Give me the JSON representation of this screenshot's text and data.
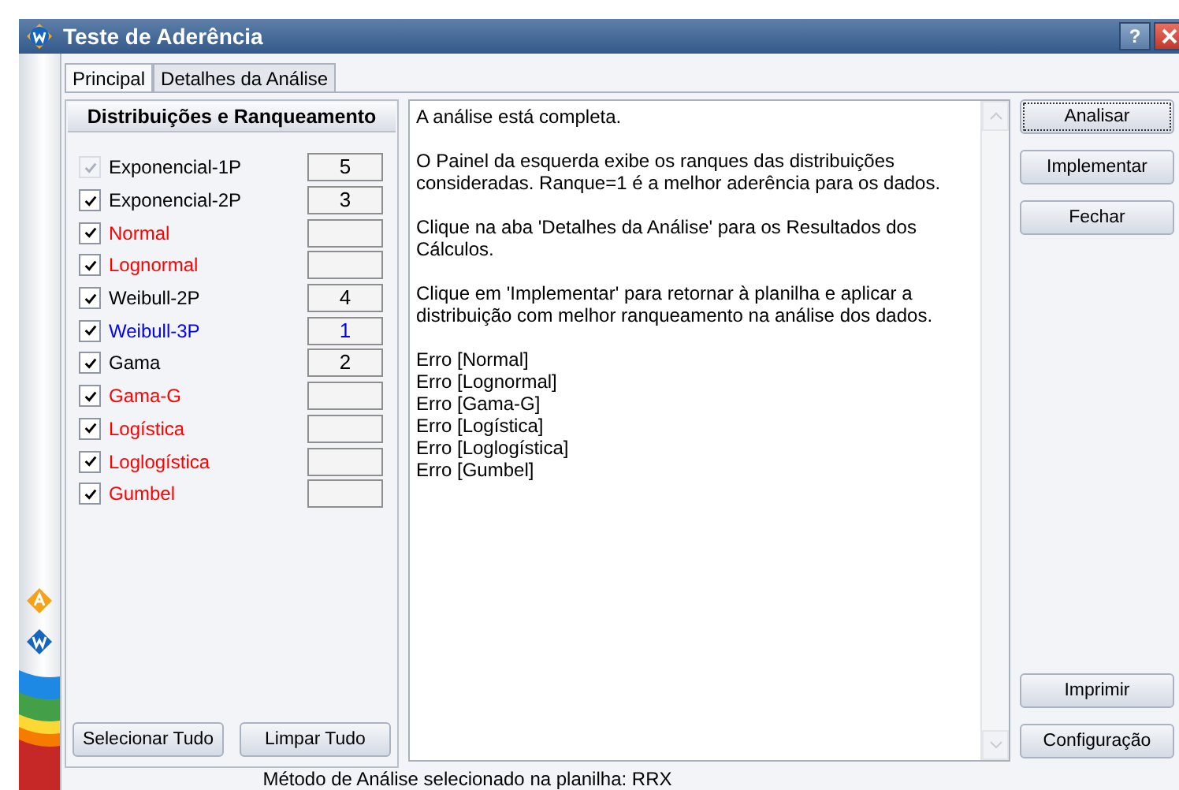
{
  "window": {
    "title": "Teste de Aderência"
  },
  "title_buttons": [
    {
      "kind": "help",
      "label": "?"
    },
    {
      "kind": "close"
    }
  ],
  "tabs": [
    {
      "label": "Principal",
      "selected": true
    },
    {
      "label": "Detalhes da Análise",
      "selected": false
    }
  ],
  "panel": {
    "title": "Distribuições e Ranqueamento",
    "distributions": [
      {
        "name": "Exponencial-1P",
        "checked": true,
        "disabled": true,
        "color": "#000000",
        "rank": "5"
      },
      {
        "name": "Exponencial-2P",
        "checked": true,
        "disabled": false,
        "color": "#000000",
        "rank": "3"
      },
      {
        "name": "Normal",
        "checked": true,
        "disabled": false,
        "color": "#ff0000"
      },
      {
        "name": "Lognormal",
        "checked": true,
        "disabled": false,
        "color": "#ff0000"
      },
      {
        "name": "Weibull-2P",
        "checked": true,
        "disabled": false,
        "color": "#000000",
        "rank": "4"
      },
      {
        "name": "Weibull-3P",
        "checked": true,
        "disabled": false,
        "color": "#0000ff",
        "rank": "1"
      },
      {
        "name": "Gama",
        "checked": true,
        "disabled": false,
        "color": "#000000",
        "rank": "2"
      },
      {
        "name": "Gama-G",
        "checked": true,
        "disabled": false,
        "color": "#ff0000"
      },
      {
        "name": "Logística",
        "checked": true,
        "disabled": false,
        "color": "#ff0000"
      },
      {
        "name": "Loglogística",
        "checked": true,
        "disabled": false,
        "color": "#ff0000"
      },
      {
        "name": "Gumbel",
        "checked": true,
        "disabled": false,
        "color": "#ff0000"
      }
    ],
    "buttons": [
      "Selecionar Tudo",
      "Limpar Tudo"
    ]
  },
  "results": {
    "paragraphs": [
      {
        "lines": [
          "A análise está completa."
        ]
      },
      {
        "lines": [
          "O Painel da esquerda exibe os ranques das distribuições",
          "consideradas. Ranque=1 é a melhor aderência para os dados."
        ]
      },
      {
        "lines": [
          "Clique na aba 'Detalhes da Análise' para os Resultados dos",
          "Cálculos."
        ]
      },
      {
        "lines": [
          "Clique em 'Implementar' para retornar à planilha e aplicar a",
          "distribuição com melhor ranqueamento na análise dos dados."
        ]
      }
    ],
    "errors": [
      "Erro [Normal]",
      "Erro [Lognormal]",
      "Erro [Gama-G]",
      "Erro [Logística]",
      "Erro [Loglogística]",
      "Erro [Gumbel]"
    ]
  },
  "actions_top": [
    "Analisar",
    "Implementar",
    "Fechar"
  ],
  "actions_bottom": [
    "Imprimir",
    "Configuração"
  ],
  "status_bar": "Método de Análise selecionado na planilha: RRX"
}
